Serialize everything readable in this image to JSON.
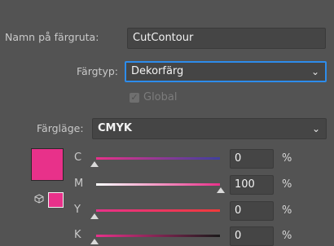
{
  "name_label": "Namn på färgruta:",
  "name_value": "CutContour",
  "type_label": "Färgtyp:",
  "type_value": "Dekorfärg",
  "global_label": "Global",
  "mode_label": "Färgläge:",
  "mode_value": "CMYK",
  "swatch_color": "#e8318a",
  "channels": [
    {
      "label": "C",
      "value": "0",
      "unit": "%"
    },
    {
      "label": "M",
      "value": "100",
      "unit": "%"
    },
    {
      "label": "Y",
      "value": "0",
      "unit": "%"
    },
    {
      "label": "K",
      "value": "0",
      "unit": "%"
    }
  ]
}
